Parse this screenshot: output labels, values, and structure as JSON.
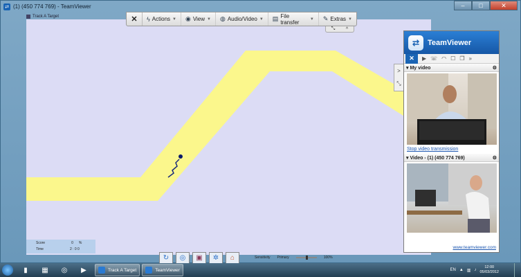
{
  "window": {
    "title": "(1) (450 774 769) - TeamViewer",
    "controls": {
      "minimize": "–",
      "maximize": "□",
      "close": "✕"
    }
  },
  "app": {
    "title": "Track A Target"
  },
  "toolbar": {
    "close": "✕",
    "items": [
      {
        "label": "Actions",
        "icon": "lightning-icon"
      },
      {
        "label": "View",
        "icon": "eye-icon"
      },
      {
        "label": "Audio/Video",
        "icon": "audio-video-icon"
      },
      {
        "label": "File transfer",
        "icon": "file-transfer-icon"
      },
      {
        "label": "Extras",
        "icon": "extras-icon"
      }
    ],
    "sub": {
      "fullscreen": "⤡",
      "collapse": "^"
    }
  },
  "side_tab": {
    "expand": ">",
    "fullscreen": "⤡"
  },
  "teamviewer_panel": {
    "brand": "TeamViewer",
    "my_video_title": "My video",
    "stop_link": "Stop video transmission",
    "remote_video_title": "Video - (1) (450 774 769)",
    "footer": "www.teamviewer.com"
  },
  "score_panel": {
    "score_label": "Score",
    "score_value": "0",
    "score_unit": "%",
    "time_label": "Time",
    "time_value": "2 : 0 0"
  },
  "sensitivity": {
    "label": "Sensitivity",
    "mode": "Primary",
    "value": "100%"
  },
  "taskbar": {
    "tasks": [
      {
        "label": "Track A Target"
      },
      {
        "label": "TeamViewer"
      }
    ],
    "tray": {
      "lang": "EN",
      "time": "12:00",
      "date": "05/03/2012"
    }
  }
}
